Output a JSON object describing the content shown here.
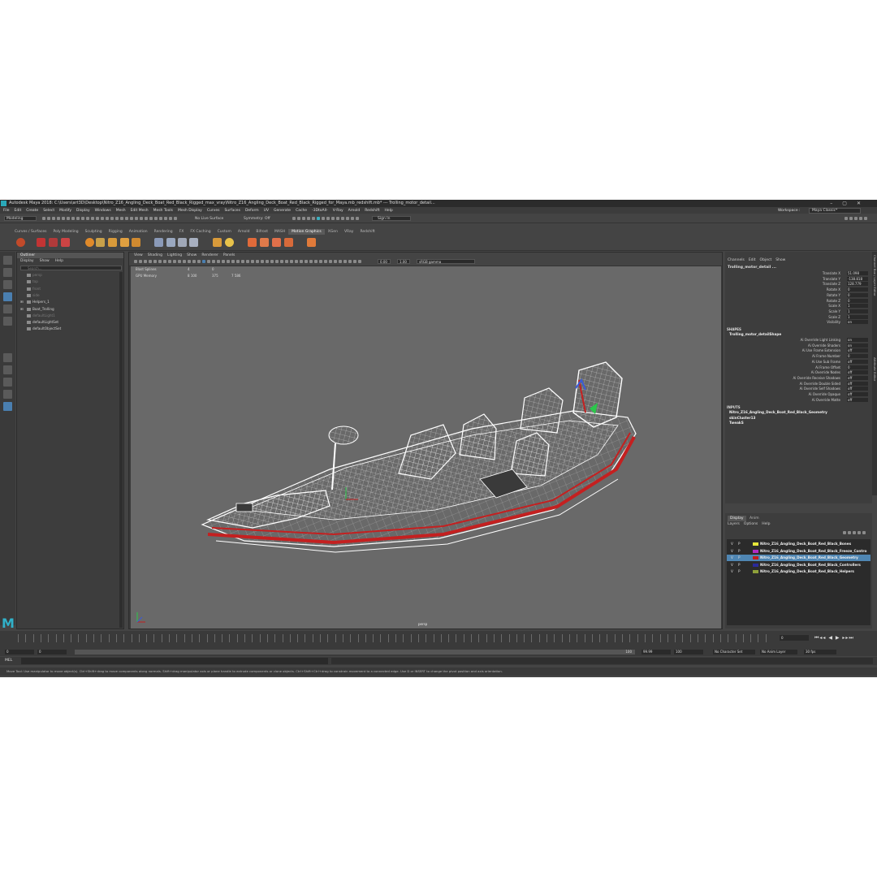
{
  "window": {
    "title": "Autodesk Maya 2018: C:\\Users\\art3D\\Desktop\\Nitro_Z16_Angling_Deck_Boat_Red_Black_Rigged_max_vray\\Nitro_Z16_Angling_Deck_Boat_Red_Black_Rigged_for_Maya.mb_redshift.mb* --- Trolling_motor_detail..."
  },
  "menubar": {
    "items": [
      "File",
      "Edit",
      "Create",
      "Select",
      "Modify",
      "Display",
      "Windows",
      "Mesh",
      "Edit Mesh",
      "Mesh Tools",
      "Mesh Display",
      "Curves",
      "Surfaces",
      "Deform",
      "UV",
      "Generate",
      "Cache",
      "-3DtoAll-",
      "V-Ray",
      "Arnold",
      "Redshift",
      "Help"
    ],
    "workspace_label": "Workspace :",
    "workspace_value": "Maya Classic*"
  },
  "statusline": {
    "mode": "Modeling",
    "live_surface": "No Live Surface",
    "symmetry": "Symmetry: Off",
    "sign_in": "Sign In"
  },
  "shelf": {
    "tabs": [
      "Curves / Surfaces",
      "Poly Modeling",
      "Sculpting",
      "Rigging",
      "Animation",
      "Rendering",
      "FX",
      "FX Caching",
      "Custom",
      "Arnold",
      "Bifrost",
      "MASH",
      "Motion Graphics",
      "XGen",
      "VRay",
      "Redshift"
    ],
    "active_tab": "Motion Graphics"
  },
  "outliner": {
    "title": "Outliner",
    "menu": [
      "Display",
      "Show",
      "Help"
    ],
    "search_placeholder": "Search...",
    "items": [
      {
        "label": "persp",
        "dim": true
      },
      {
        "label": "top",
        "dim": true
      },
      {
        "label": "front",
        "dim": true
      },
      {
        "label": "side",
        "dim": true
      },
      {
        "label": "Helpers_1",
        "dim": false,
        "expand": "+"
      },
      {
        "label": "Boat_Trolling",
        "dim": false,
        "expand": "+"
      },
      {
        "label": "defaultLight1",
        "dim": true
      },
      {
        "label": "defaultLightSet",
        "dim": false
      },
      {
        "label": "defaultObjectSet",
        "dim": false
      }
    ]
  },
  "viewport": {
    "menu": [
      "View",
      "Shading",
      "Lighting",
      "Show",
      "Renderer",
      "Panels"
    ],
    "field_a": "0.00",
    "field_b": "1.00",
    "color_space": "sRGB gamma",
    "hud": [
      {
        "label": "Blast Splines",
        "c1": "4",
        "c2": "0",
        "c3": ""
      },
      {
        "label": "GPU Memory",
        "c1": "8 100",
        "c2": "375",
        "c3": "7 586"
      }
    ],
    "camera_label": "persp"
  },
  "channel_box": {
    "menu": [
      "Channels",
      "Edit",
      "Object",
      "Show"
    ],
    "object_name": "Trolling_motor_detail ...",
    "transform": [
      {
        "name": "Translate X",
        "value": "51.098"
      },
      {
        "name": "Translate Y",
        "value": "-138.818"
      },
      {
        "name": "Translate Z",
        "value": "128.779"
      },
      {
        "name": "Rotate X",
        "value": "0"
      },
      {
        "name": "Rotate Y",
        "value": "0"
      },
      {
        "name": "Rotate Z",
        "value": "0"
      },
      {
        "name": "Scale X",
        "value": "1"
      },
      {
        "name": "Scale Y",
        "value": "1"
      },
      {
        "name": "Scale Z",
        "value": "1"
      },
      {
        "name": "Visibility",
        "value": "on"
      }
    ],
    "shapes_header": "SHAPES",
    "shape_name": "Trolling_motor_detailShape",
    "shape_attrs": [
      {
        "name": "Ai Override Light Linking",
        "value": "on"
      },
      {
        "name": "Ai Override Shaders",
        "value": "on"
      },
      {
        "name": "Ai Use Frame Extension",
        "value": "off"
      },
      {
        "name": "Ai Frame Number",
        "value": "0"
      },
      {
        "name": "Ai Use Sub Frame",
        "value": "off"
      },
      {
        "name": "Ai Frame Offset",
        "value": "0"
      },
      {
        "name": "Ai Override Nodes",
        "value": "off"
      },
      {
        "name": "Ai Override Receive Shadows",
        "value": "off"
      },
      {
        "name": "Ai Override Double Sided",
        "value": "off"
      },
      {
        "name": "Ai Override Self Shadows",
        "value": "off"
      },
      {
        "name": "Ai Override Opaque",
        "value": "off"
      },
      {
        "name": "Ai Override Matte",
        "value": "off"
      }
    ],
    "inputs_header": "INPUTS",
    "inputs": [
      "Nitro_Z16_Angling_Deck_Boat_Red_Black_Geometry",
      "skinCluster13",
      "TweakS"
    ]
  },
  "side_tabs": [
    "Channel Box / Layer Editor",
    "Attribute Editor"
  ],
  "layer_editor": {
    "tabs": [
      "Display",
      "Anim"
    ],
    "active_tab": "Display",
    "menu": [
      "Layers",
      "Options",
      "Help"
    ],
    "layers": [
      {
        "v": "V",
        "p": "P",
        "color": "#e6e63a",
        "name": "Nitro_Z16_Angling_Deck_Boat_Red_Black_Bones",
        "selected": false
      },
      {
        "v": "V",
        "p": "P",
        "color": "#b02cc4",
        "name": "Nitro_Z16_Angling_Deck_Boat_Red_Black_Freeze_Contro",
        "selected": false
      },
      {
        "v": "V",
        "p": "P",
        "color": "#c41c1c",
        "name": "Nitro_Z16_Angling_Deck_Boat_Red_Black_Geometry",
        "selected": true
      },
      {
        "v": "V",
        "p": "P",
        "color": "#2a2a9a",
        "name": "Nitro_Z16_Angling_Deck_Boat_Red_Black_Controllers",
        "selected": false
      },
      {
        "v": "V",
        "p": "P",
        "color": "#8ea03a",
        "name": "Nitro_Z16_Angling_Deck_Boat_Red_Black_Helpers",
        "selected": false
      }
    ]
  },
  "time": {
    "current_frame": "0",
    "range_start": "0",
    "range_start2": "0",
    "range_end_inner": "100",
    "range_end": "99.99",
    "range_end2": "100",
    "character_set": "No Character Set",
    "anim_layer": "No Anim Layer",
    "fps": "30 fps"
  },
  "command_line": {
    "label": "MEL"
  },
  "help_line": {
    "text": "Move Tool: Use manipulator to move object(s). Ctrl+Shift+drag to move components along normals. Shift+drag manipulator axis or plane handle to extrude components or clone objects. Ctrl+Shift+Ctrl+drag to constrain movement to a connected edge. Use D or INSERT to change the pivot position and axis orientation."
  },
  "colors": {
    "app_bg": "#444444",
    "viewport_bg": "#696969",
    "accent": "#31b1c9",
    "boat_red": "#c42020",
    "wire": "#ffffff"
  }
}
